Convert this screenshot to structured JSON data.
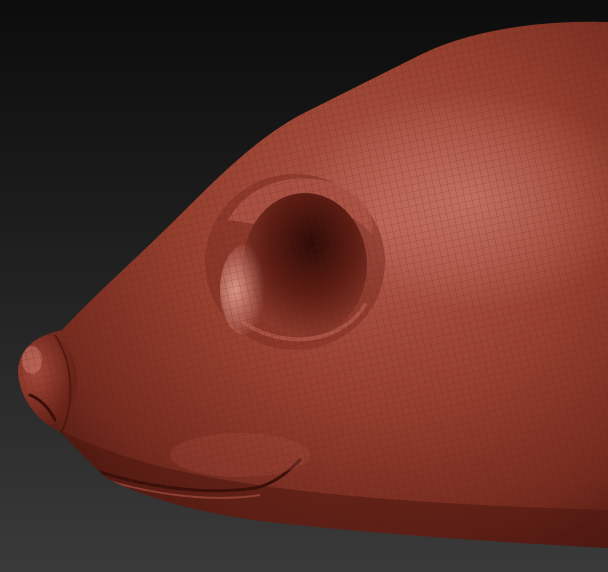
{
  "viewport": {
    "background_top": "#0c0c0c",
    "background_bottom": "#3a3a3a",
    "subject": "sculpt-head-mesh"
  },
  "material": {
    "base_color": "#8e3a2e",
    "shadow_color": "#3f120c",
    "highlight_color": "#d88a7c",
    "wire_color": "#5a1e16"
  },
  "display": {
    "wireframe_overlay": true
  }
}
